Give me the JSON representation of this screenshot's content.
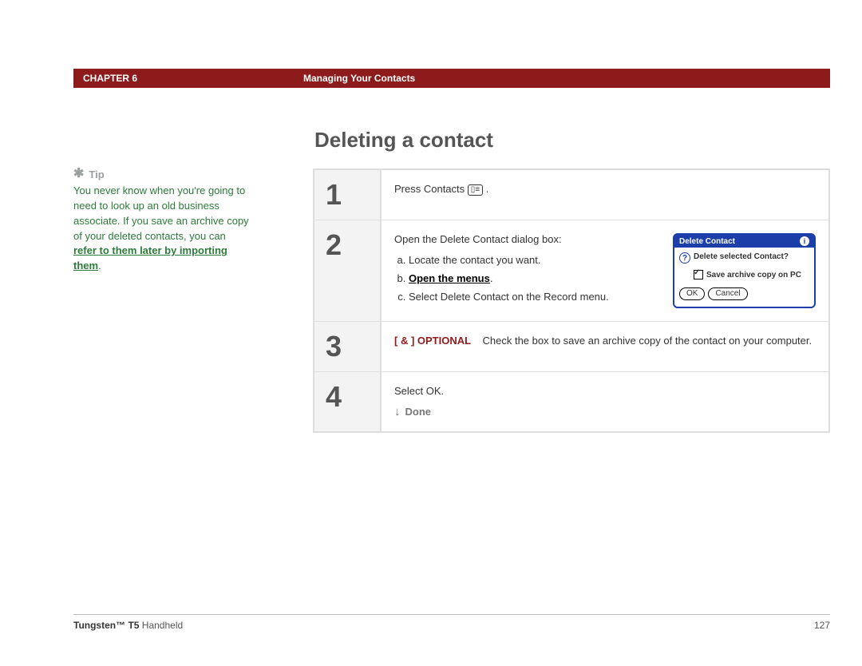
{
  "header": {
    "chapter": "CHAPTER 6",
    "title": "Managing Your Contacts"
  },
  "section_title": "Deleting a contact",
  "tip": {
    "label": "Tip",
    "body_before": "You never know when you're going to need to look up an old business associate. If you save an archive copy of your deleted contacts, you can ",
    "link": "refer to them later by importing them",
    "body_after": "."
  },
  "steps": {
    "s1": {
      "num": "1",
      "text": "Press Contacts "
    },
    "s2": {
      "num": "2",
      "intro": "Open the Delete Contact dialog box:",
      "a": "Locate the contact you want.",
      "b_label": "Open the menus",
      "b_after": ".",
      "c": "Select Delete Contact on the Record menu.",
      "dialog": {
        "title": "Delete Contact",
        "question": "Delete selected Contact?",
        "checkbox": "Save archive copy on PC",
        "ok": "OK",
        "cancel": "Cancel"
      }
    },
    "s3": {
      "num": "3",
      "optional_tag": "[ & ] OPTIONAL",
      "text": "Check the box to save an archive copy of the contact on your computer."
    },
    "s4": {
      "num": "4",
      "text": "Select OK.",
      "done": "Done"
    }
  },
  "footer": {
    "product_bold": "Tungsten™ T5",
    "product_rest": " Handheld",
    "page": "127"
  }
}
